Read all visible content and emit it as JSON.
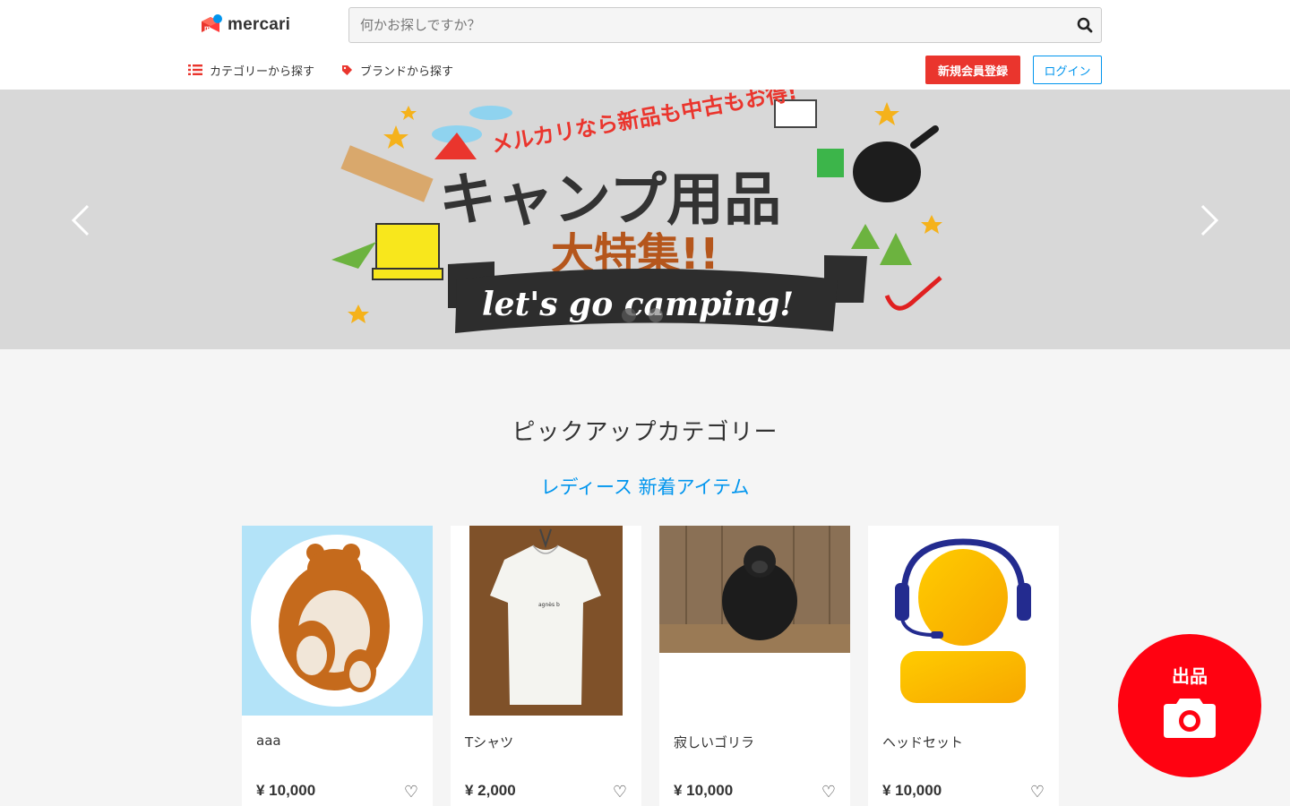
{
  "header": {
    "logo_text": "mercari",
    "search_placeholder": "何かお探しですか？",
    "nav_category": "カテゴリーから探す",
    "nav_brand": "ブランドから探す",
    "signup_label": "新規会員登録",
    "login_label": "ログイン"
  },
  "banner": {
    "headline_top": "メルカリなら新品も中古もお得!",
    "headline_main": "キャンプ用品",
    "headline_sub": "大特集!!",
    "ribbon_text": "let's go camping!",
    "slide_count": 2,
    "active_slide": 1
  },
  "section": {
    "title": "ピックアップカテゴリー",
    "subtitle": "レディース 新着アイテム"
  },
  "products": [
    {
      "name": "aaa",
      "price": "¥ 10,000",
      "image": "teddy-bear-image"
    },
    {
      "name": "Tシャツ",
      "price": "¥ 2,000",
      "image": "tshirt-image"
    },
    {
      "name": "寂しいゴリラ",
      "price": "¥ 10,000",
      "image": "gorilla-image"
    },
    {
      "name": "ヘッドセット",
      "price": "¥ 10,000",
      "image": "headset-image"
    }
  ],
  "sell_button": {
    "label": "出品",
    "icon": "camera-icon"
  },
  "colors": {
    "brand_red": "#ea352d",
    "link_blue": "#0095ee",
    "sell_red": "#ff0211"
  }
}
